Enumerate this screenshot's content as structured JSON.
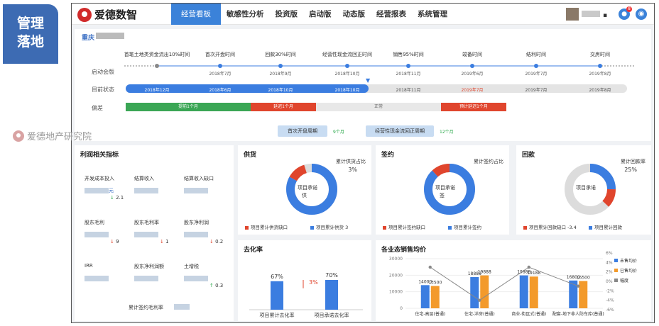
{
  "side_badge": {
    "line1": "管理",
    "line2": "落地"
  },
  "watermark": "爱德地产研究院",
  "app": {
    "logo": "爱德数智"
  },
  "nav": [
    {
      "label": "经营看板",
      "active": true
    },
    {
      "label": "敏感性分析"
    },
    {
      "label": "投资版"
    },
    {
      "label": "启动版"
    },
    {
      "label": "动态版"
    },
    {
      "label": "经营报表"
    },
    {
      "label": "系统管理"
    }
  ],
  "header": {
    "dot": "▪",
    "bell_count": "8"
  },
  "timeline": {
    "project": "重庆",
    "row_labels": {
      "start": "启动会版",
      "status": "目前状态",
      "deviation": "偏差"
    },
    "milestones": [
      {
        "name": "首笔土地类资金流出10%时间",
        "date": ""
      },
      {
        "name": "首次开盘时间",
        "date": "2018年7月"
      },
      {
        "name": "回款30%时间",
        "date": "2018年9月"
      },
      {
        "name": "经营性现金流回正时间",
        "date": "2018年10月"
      },
      {
        "name": "销售95%时间",
        "date": "2018年11月"
      },
      {
        "name": "竣备时间",
        "date": "2019年6月"
      },
      {
        "name": "结利时间",
        "date": "2019年7月"
      },
      {
        "name": "交房时间",
        "date": "2019年8月"
      }
    ],
    "status_dates": [
      "2018年12月",
      "2018年6月",
      "2018年10月",
      "2018年10月",
      "2018年11月",
      "2019年7月",
      "2019年7月",
      "2019年8月"
    ],
    "deviation": [
      {
        "label": "提前1个月",
        "color": "#3aa655"
      },
      {
        "label": "延迟1个月",
        "color": "#e0452d"
      },
      {
        "label": "正常",
        "color": "#e8e8e8"
      },
      {
        "label": "预计延迟1个月",
        "color": "#e0452d"
      }
    ],
    "cycles": [
      {
        "label": "首次开盘周期",
        "value": "9个月"
      },
      {
        "label": "经营性现金流回正周期",
        "value": "12个月"
      }
    ]
  },
  "profit": {
    "title": "利润相关指标",
    "items": [
      {
        "label": "开发成本投入",
        "value": "元",
        "change": "2.1",
        "dir": "down",
        "color": "#2aa84a"
      },
      {
        "label": "结算收入",
        "value": "",
        "change": "",
        "dir": "",
        "color": ""
      },
      {
        "label": "结算收入缺口",
        "value": "",
        "change": "",
        "dir": "",
        "color": ""
      },
      {
        "label": "股东毛利",
        "value": "",
        "change": "9",
        "dir": "down",
        "color": "#e0452d"
      },
      {
        "label": "股东毛利率",
        "value": "",
        "change": "1",
        "dir": "down",
        "color": "#e0452d"
      },
      {
        "label": "股东净利润",
        "value": "",
        "change": "0.2",
        "dir": "down",
        "color": "#e0452d"
      },
      {
        "label": "IRR",
        "value": "",
        "change": "",
        "dir": "",
        "color": ""
      },
      {
        "label": "股东净利润额",
        "value": "",
        "change": "",
        "dir": "",
        "color": ""
      },
      {
        "label": "土增税",
        "value": "",
        "change": "0.3",
        "dir": "up",
        "color": "#2aa84a"
      }
    ],
    "bottom_label": "累计签约毛利率"
  },
  "donuts": [
    {
      "title": "供货",
      "side_label": "累计供货占比",
      "side_value": "3%",
      "center": "项目承诺",
      "center2": "供",
      "pct": 0.83,
      "legend": [
        {
          "text": "项目累计供货缺口",
          "color": "#e0452d"
        },
        {
          "text": "项目累计供货 3",
          "color": "#3b7de0"
        }
      ]
    },
    {
      "title": "签约",
      "side_label": "累计签约占比",
      "side_value": "",
      "center": "项目承诺",
      "center2": "签",
      "pct": 0.88,
      "legend": [
        {
          "text": "项目累计签约缺口",
          "color": "#e0452d"
        },
        {
          "text": "项目累计签约",
          "color": "#3b7de0"
        }
      ]
    },
    {
      "title": "回款",
      "side_label": "累计回款率",
      "side_value": "25%",
      "center": "项目承诺",
      "center2": "",
      "pct": 0.25,
      "legend": [
        {
          "text": "项目累计回款缺口 -3.4",
          "color": "#e0452d"
        },
        {
          "text": "项目累计回款",
          "color": "#3b7de0"
        }
      ]
    }
  ],
  "destock": {
    "title": "去化率",
    "delta": "3%",
    "categories": [
      "项目累计去化率",
      "项目承诺去化率"
    ],
    "values": [
      67,
      70
    ],
    "labels": [
      "67%",
      "70%"
    ]
  },
  "chart_data": {
    "type": "bar",
    "title": "各业态销售均价",
    "categories": [
      "住宅-高层(普通)",
      "住宅-洋房(普通)",
      "商业-街区式(普通)",
      "配套-地下非人防车库(普通)"
    ],
    "series": [
      {
        "name": "未售均价",
        "color": "#3b7de0",
        "values": [
          14000,
          18888,
          19888,
          16800
        ]
      },
      {
        "name": "已售均价",
        "color": "#f39a2b",
        "values": [
          13500,
          19888,
          19188,
          16500
        ]
      },
      {
        "name": "幅度",
        "color": "#888888",
        "type": "line",
        "values": [
          3,
          -4,
          3,
          -1
        ]
      }
    ],
    "value_labels": [
      [
        "14000",
        "18888",
        "19888",
        "16800"
      ],
      [
        "13500",
        "19888",
        "19188",
        "16500"
      ]
    ],
    "y_ticks": [
      "30000",
      "20000",
      "10000",
      "0"
    ],
    "y2_ticks": [
      "6%",
      "4%",
      "2%",
      "0%",
      "-2%",
      "-4%",
      "-6%"
    ],
    "ylim": [
      0,
      30000
    ],
    "y2lim": [
      -6,
      6
    ]
  }
}
